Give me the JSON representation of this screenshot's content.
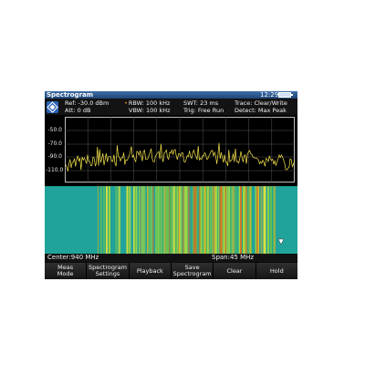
{
  "window": {
    "title": "Spectrogram",
    "time": "12:29"
  },
  "params": {
    "ref": "Ref: -30.0 dBm",
    "att": "Att:  0 dB",
    "rbw": "RBW:  100 kHz",
    "vbw": "VBW:  100 kHz",
    "swt": "SWT:   23 ms",
    "trig": "Trig:  Free Run",
    "trace": "Trace:  Clear/Write",
    "detect": "Detect:  Max Peak"
  },
  "y_axis": {
    "labels": [
      "-50.0",
      "-70.0",
      "-90.0",
      "-110.0"
    ]
  },
  "status": {
    "center": "Center:940 MHz",
    "span": "Span:45 MHz"
  },
  "softkeys": [
    {
      "line1": "Meas",
      "line2": "Mode"
    },
    {
      "line1": "Spectrogram",
      "line2": "Settings"
    },
    {
      "line1": "Playback",
      "line2": ""
    },
    {
      "line1": "Save",
      "line2": "Spectrogram"
    },
    {
      "line1": "Clear",
      "line2": ""
    },
    {
      "line1": "Hold",
      "line2": ""
    }
  ],
  "icons": {
    "logo": "rohde-schwarz-logo",
    "battery": "battery-icon",
    "marker": "marker-icon"
  },
  "colors": {
    "trace": "#f4e34a",
    "waterfall_base": "#20a39a",
    "title_bar": "#2b5a94",
    "grid": "#bdbdbd"
  }
}
